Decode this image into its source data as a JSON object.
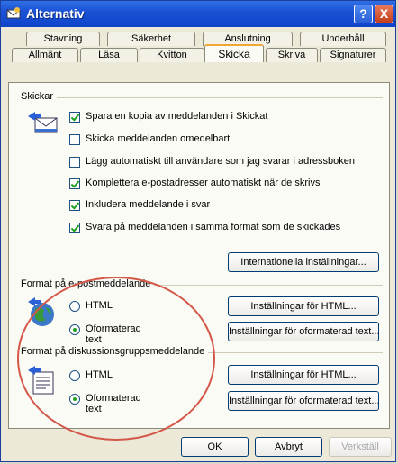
{
  "window": {
    "title": "Alternativ",
    "help_label": "?",
    "close_label": "X"
  },
  "tabs_back": [
    "Stavning",
    "Säkerhet",
    "Anslutning",
    "Underhåll"
  ],
  "tabs_front": [
    "Allmänt",
    "Läsa",
    "Kvitton",
    "Skicka",
    "Skriva",
    "Signaturer"
  ],
  "active_tab": "Skicka",
  "skickar": {
    "label": "Skickar",
    "options": [
      {
        "label": "Spara en kopia av meddelanden i Skickat",
        "checked": true
      },
      {
        "label": "Skicka meddelanden omedelbart",
        "checked": false
      },
      {
        "label": "Lägg automatiskt till användare som jag svarar i adressboken",
        "checked": false
      },
      {
        "label": "Komplettera e-postadresser automatiskt när de skrivs",
        "checked": true
      },
      {
        "label": "Inkludera meddelande i svar",
        "checked": true
      },
      {
        "label": "Svara på meddelanden i samma format som de skickades",
        "checked": true
      }
    ],
    "intl_button": "Internationella inställningar..."
  },
  "email_format": {
    "label": "Format på e-postmeddelande",
    "radio_html": "HTML",
    "radio_plain": "Oformaterad text",
    "selected": "Oformaterad text",
    "html_settings_button": "Inställningar för HTML...",
    "plain_settings_button": "Inställningar för oformaterad text..."
  },
  "news_format": {
    "label": "Format på diskussionsgruppsmeddelande",
    "radio_html": "HTML",
    "radio_plain": "Oformaterad text",
    "selected": "Oformaterad text",
    "html_settings_button": "Inställningar för HTML...",
    "plain_settings_button": "Inställningar för oformaterad text..."
  },
  "footer": {
    "ok": "OK",
    "cancel": "Avbryt",
    "apply": "Verkställ"
  },
  "colors": {
    "titlebar": "#1a52d6",
    "annotation_ellipse": "#d4584a",
    "check": "#21a121"
  }
}
